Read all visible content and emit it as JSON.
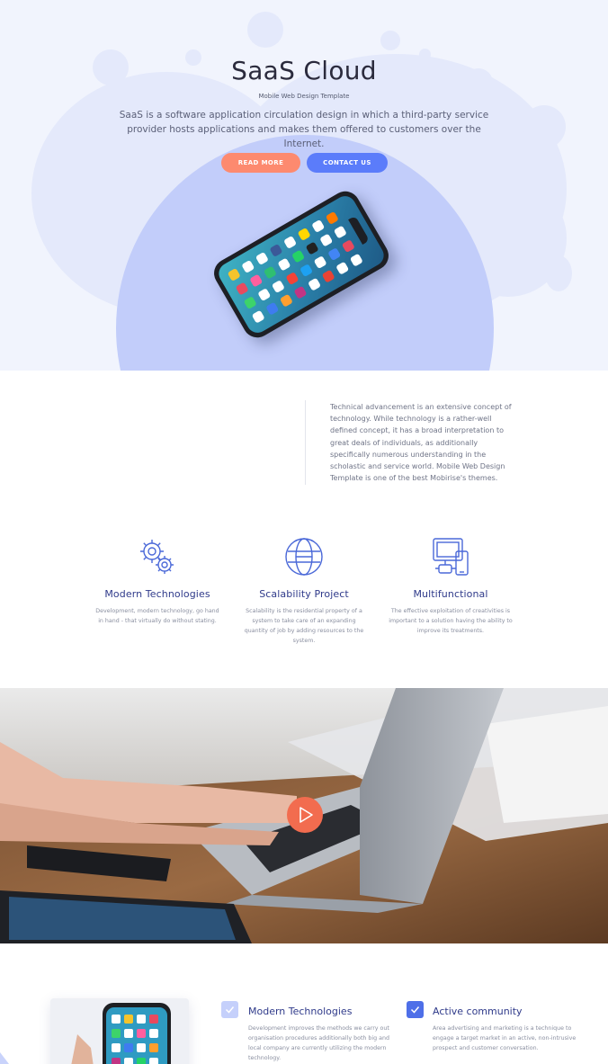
{
  "hero": {
    "title": "SaaS Cloud",
    "subtitle": "Mobile Web Design Template",
    "description": "SaaS is a software application circulation design in which a third-party service provider hosts applications and makes them offered to customers over the Internet.",
    "read_more_label": "READ MORE",
    "contact_label": "CONTACT US"
  },
  "intro": {
    "text": "Technical advancement is an extensive concept of technology. While technology is a rather-well defined concept, it has a broad interpretation to great deals of individuals, as additionally specifically numerous understanding in the scholastic and service world. Mobile Web Design Template is one of the best Mobirise's themes."
  },
  "features": [
    {
      "icon": "gears-icon",
      "title": "Modern Technologies",
      "text": "Development, modern technology, go hand in hand - that virtually do without stating."
    },
    {
      "icon": "globe-icon",
      "title": "Scalability Project",
      "text": "Scalability is the residential property of a system to take care of an expanding quantity of job by adding resources to the system."
    },
    {
      "icon": "devices-icon",
      "title": "Multifunctional",
      "text": "The effective exploitation of creativities is important to a solution having the ability to improve its treatments."
    }
  ],
  "bottom": {
    "items": [
      {
        "icon": "check-icon",
        "title": "Modern Technologies",
        "text": "Development improves the methods we carry out organisation procedures additionally both big and local company are currently utilizing the modern technology."
      },
      {
        "icon": "check-icon",
        "title": "Active community",
        "text": "Area advertising and marketing is a technique to engage a target market in an active, non-intrusive prospect and customer conversation."
      }
    ]
  },
  "colors": {
    "accent_orange": "#fd8a6f",
    "accent_blue": "#5b7cfa",
    "heading_blue": "#2f3a8a",
    "hero_bg": "#f1f4fd"
  }
}
